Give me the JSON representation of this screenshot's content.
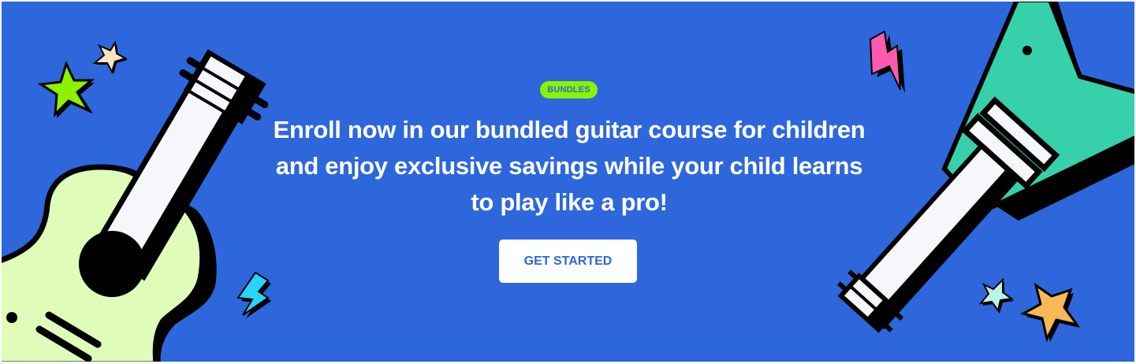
{
  "banner": {
    "badge": "BUNDLES",
    "headline": "Enroll now in our bundled guitar course for children and enjoy exclusive savings while your child learns to play like a pro!",
    "cta_label": "GET STARTED"
  },
  "colors": {
    "background": "#2d67db",
    "badge": "#8bf200",
    "acoustic_body": "#dffcb8",
    "electric_body": "#36d1aa",
    "neck": "#f6f7fa"
  }
}
